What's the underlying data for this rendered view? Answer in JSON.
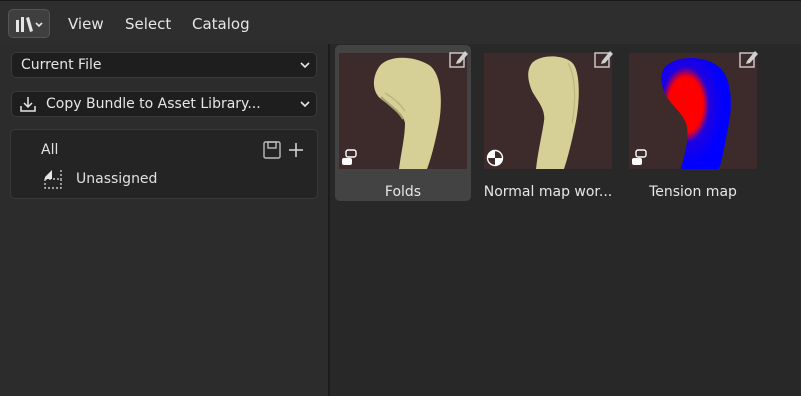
{
  "header": {
    "editor_icon": "asset-browser-icon",
    "menus": [
      "View",
      "Select",
      "Catalog"
    ]
  },
  "sidebar": {
    "library_select": "Current File",
    "action_select": "Copy Bundle to Asset Library...",
    "catalogs": {
      "all_label": "All",
      "unassigned_label": "Unassigned"
    }
  },
  "assets": [
    {
      "name": "Folds",
      "type_icon": "node-group-icon",
      "selected": true
    },
    {
      "name": "Normal map wor...",
      "type_icon": "material-icon",
      "selected": false
    },
    {
      "name": "Tension map",
      "type_icon": "node-group-icon",
      "selected": false
    }
  ],
  "colors": {
    "background": "#282828",
    "sidebar": "#2c2c2c",
    "selection": "#434343",
    "mesh": "#d6cf96",
    "tension_red": "#ff0000",
    "tension_blue": "#0000ff"
  }
}
